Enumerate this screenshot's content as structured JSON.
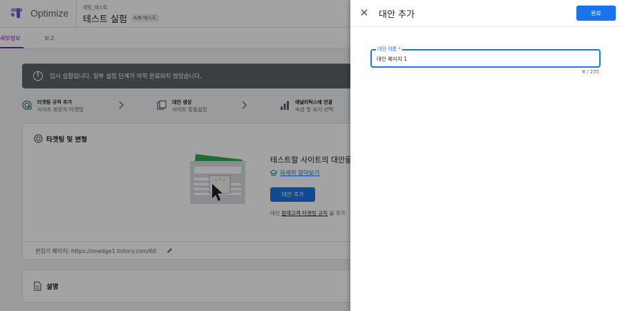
{
  "app": {
    "name": "Optimize",
    "container_name": "레빗_테스트",
    "experiment_name": "테스트 실험",
    "experiment_type": "A/B 테스트"
  },
  "tabs": [
    {
      "label": "세부정보",
      "active": true
    },
    {
      "label": "보고",
      "active": false
    }
  ],
  "banner": {
    "icon": "info-icon",
    "text": "임시 실험입니다.  일부 설정 단계가 아직 완료되지 않았습니다."
  },
  "steps": [
    {
      "icon": "target-check-icon",
      "title": "타겟팅 규칙 추가",
      "subtitle": "사이트 방문자 타겟팅"
    },
    {
      "icon": "copy-icon",
      "title": "대안 생성",
      "subtitle": "사이트 맞춤설정"
    },
    {
      "icon": "bar-chart-icon",
      "title": "애널리틱스에 연결",
      "subtitle": "속성 및 보기 선택"
    }
  ],
  "targeting_card": {
    "title": "타겟팅 및 변형",
    "empty_title": "테스트할 사이트의 대안을",
    "learn_more": "자세히 알아보기",
    "add_variant_button": "대안 추가",
    "alt_prefix": "대신",
    "alt_link": "잠재고객 타겟팅 규칙",
    "alt_suffix": "을 추가",
    "editor_page_label": "편집기 페이지: https://onedge1.tistory.com/60"
  },
  "description_card": {
    "title": "설명"
  },
  "panel": {
    "title": "대안 추가",
    "done_button": "완료",
    "field_label": "대안 이름",
    "required_mark": "*",
    "field_value": "대안 페이지 1",
    "char_count": "8 / 255"
  },
  "colors": {
    "accent": "#1a73e8",
    "tab_active": "#7b1fa2",
    "banner_bg": "#5f6368",
    "required": "#d93025"
  }
}
